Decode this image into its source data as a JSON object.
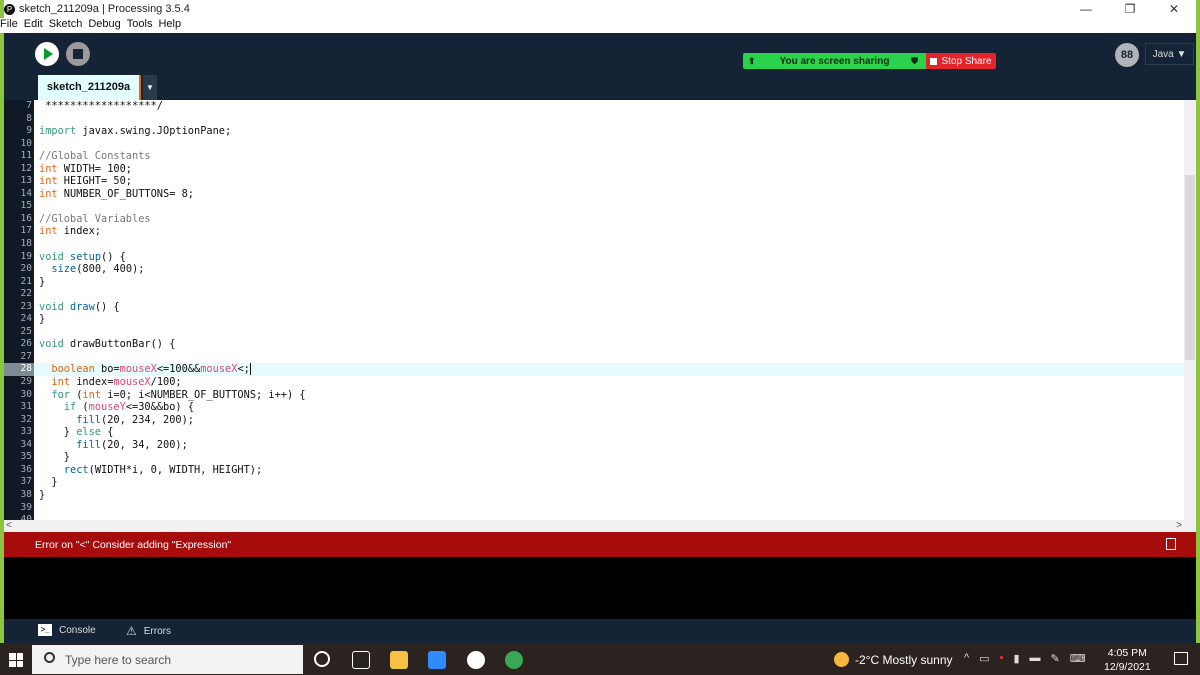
{
  "window": {
    "title": "sketch_211209a | Processing 3.5.4",
    "logo": "P",
    "minimize": "—",
    "restore": "❐",
    "close": "✕"
  },
  "menu": [
    "File",
    "Edit",
    "Sketch",
    "Debug",
    "Tools",
    "Help"
  ],
  "toolbar": {
    "run_icon": "play-icon",
    "stop_icon": "stop-icon",
    "mode_icon_text": "88",
    "mode": "Java ▼"
  },
  "zoom": {
    "sharing_text": "You are screen sharing",
    "stop_share": "Stop Share",
    "colors": {
      "share": "#2bd34c",
      "stop": "#e4242b"
    }
  },
  "tab": {
    "name": "sketch_211209a",
    "menu_arrow": "▼"
  },
  "editor": {
    "current_line": 28,
    "lines": [
      {
        "n": "7",
        "t": [
          [
            " ******************/",
            ""
          ]
        ]
      },
      {
        "n": "8",
        "t": []
      },
      {
        "n": "9",
        "t": [
          [
            "import",
            "kw"
          ],
          [
            " javax.swing.JOptionPane;",
            ""
          ]
        ]
      },
      {
        "n": "10",
        "t": []
      },
      {
        "n": "11",
        "t": [
          [
            "//Global Constants",
            "cm"
          ]
        ]
      },
      {
        "n": "12",
        "t": [
          [
            "int",
            "type"
          ],
          [
            " WIDTH= 100;",
            ""
          ]
        ]
      },
      {
        "n": "13",
        "t": [
          [
            "int",
            "type"
          ],
          [
            " HEIGHT= 50;",
            ""
          ]
        ]
      },
      {
        "n": "14",
        "t": [
          [
            "int",
            "type"
          ],
          [
            " NUMBER_OF_BUTTONS= 8;",
            ""
          ]
        ]
      },
      {
        "n": "15",
        "t": []
      },
      {
        "n": "16",
        "t": [
          [
            "//Global Variables",
            "cm"
          ]
        ]
      },
      {
        "n": "17",
        "t": [
          [
            "int",
            "type"
          ],
          [
            " index;",
            ""
          ]
        ]
      },
      {
        "n": "18",
        "t": []
      },
      {
        "n": "19",
        "t": [
          [
            "void",
            "kw"
          ],
          [
            " ",
            ""
          ],
          [
            "setup",
            "fn"
          ],
          [
            "() {",
            ""
          ]
        ]
      },
      {
        "n": "20",
        "t": [
          [
            "  ",
            ""
          ],
          [
            "size",
            "fn"
          ],
          [
            "(800, 400);",
            ""
          ]
        ]
      },
      {
        "n": "21",
        "t": [
          [
            "}",
            ""
          ]
        ]
      },
      {
        "n": "22",
        "t": []
      },
      {
        "n": "23",
        "t": [
          [
            "void",
            "kw"
          ],
          [
            " ",
            ""
          ],
          [
            "draw",
            "fn"
          ],
          [
            "() {",
            ""
          ]
        ]
      },
      {
        "n": "24",
        "t": [
          [
            "}",
            ""
          ]
        ]
      },
      {
        "n": "25",
        "t": []
      },
      {
        "n": "26",
        "t": [
          [
            "void",
            "kw"
          ],
          [
            " drawButtonBar() {",
            ""
          ]
        ]
      },
      {
        "n": "27",
        "t": []
      },
      {
        "n": "28",
        "t": [
          [
            "  ",
            ""
          ],
          [
            "boolean",
            "type"
          ],
          [
            " bo=",
            ""
          ],
          [
            "mouseX",
            "var"
          ],
          [
            "<=100&&",
            ""
          ],
          [
            "mouseX",
            "var"
          ],
          [
            "<;",
            ""
          ]
        ]
      },
      {
        "n": "29",
        "t": [
          [
            "  ",
            ""
          ],
          [
            "int",
            "type"
          ],
          [
            " index=",
            ""
          ],
          [
            "mouseX",
            "var"
          ],
          [
            "/100;",
            ""
          ]
        ]
      },
      {
        "n": "30",
        "t": [
          [
            "  ",
            ""
          ],
          [
            "for",
            "kw"
          ],
          [
            " (",
            ""
          ],
          [
            "int",
            "type"
          ],
          [
            " i=0; i<NUMBER_OF_BUTTONS; i++) {",
            ""
          ]
        ]
      },
      {
        "n": "31",
        "t": [
          [
            "    ",
            ""
          ],
          [
            "if",
            "kw"
          ],
          [
            " (",
            ""
          ],
          [
            "mouseY",
            "var"
          ],
          [
            "<=30&&bo) {",
            ""
          ]
        ]
      },
      {
        "n": "32",
        "t": [
          [
            "      ",
            ""
          ],
          [
            "fill",
            "fn"
          ],
          [
            "(20, 234, 200);",
            ""
          ]
        ]
      },
      {
        "n": "33",
        "t": [
          [
            "    } ",
            ""
          ],
          [
            "else",
            "kw"
          ],
          [
            " {",
            ""
          ]
        ]
      },
      {
        "n": "34",
        "t": [
          [
            "      ",
            ""
          ],
          [
            "fill",
            "fn"
          ],
          [
            "(20, 34, 200);",
            ""
          ]
        ]
      },
      {
        "n": "35",
        "t": [
          [
            "    }",
            ""
          ]
        ]
      },
      {
        "n": "36",
        "t": [
          [
            "    ",
            ""
          ],
          [
            "rect",
            "fn"
          ],
          [
            "(WIDTH*i, 0, WIDTH, HEIGHT);",
            ""
          ]
        ]
      },
      {
        "n": "37",
        "t": [
          [
            "  }",
            ""
          ]
        ]
      },
      {
        "n": "38",
        "t": [
          [
            "}",
            ""
          ]
        ]
      },
      {
        "n": "39",
        "t": []
      },
      {
        "n": "40",
        "t": []
      }
    ]
  },
  "scroll": {
    "left": "<",
    "right": ">",
    "up": "^",
    "down": "v"
  },
  "error": {
    "message": "Error on \"<\" Consider adding \"Expression\""
  },
  "console_tabs": {
    "console": "Console",
    "errors": "Errors",
    "console_icon": ">_",
    "errors_icon": "⚠"
  },
  "taskbar": {
    "search_placeholder": "Type here to search",
    "weather": "-2°C  Mostly sunny",
    "time": "4:05 PM",
    "date": "12/9/2021",
    "tray_expand": "^"
  }
}
